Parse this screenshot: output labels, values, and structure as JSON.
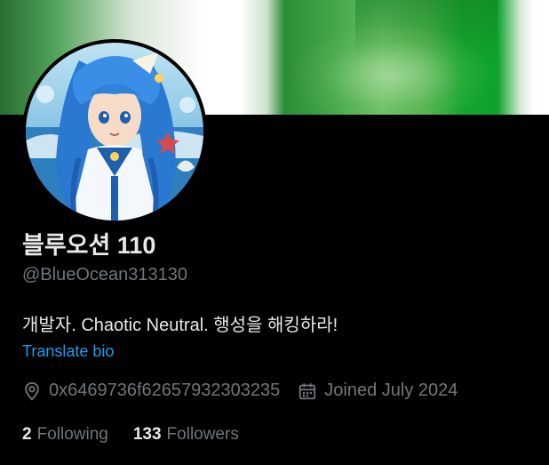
{
  "profile": {
    "display_name": "블루오션 110",
    "handle": "@BlueOcean313130",
    "bio": "개발자. Chaotic Neutral. 행성을 해킹하라!",
    "translate_label": "Translate bio",
    "location": "0x6469736f62657932303235",
    "joined": "Joined July 2024",
    "following_count": "2",
    "following_label": "Following",
    "followers_count": "133",
    "followers_label": "Followers"
  },
  "icons": {
    "location": "map-pin-icon",
    "joined": "calendar-icon"
  },
  "colors": {
    "background": "#000000",
    "primary_text": "#e7e9ea",
    "secondary_text": "#71767b",
    "link": "#1d9bf0"
  }
}
